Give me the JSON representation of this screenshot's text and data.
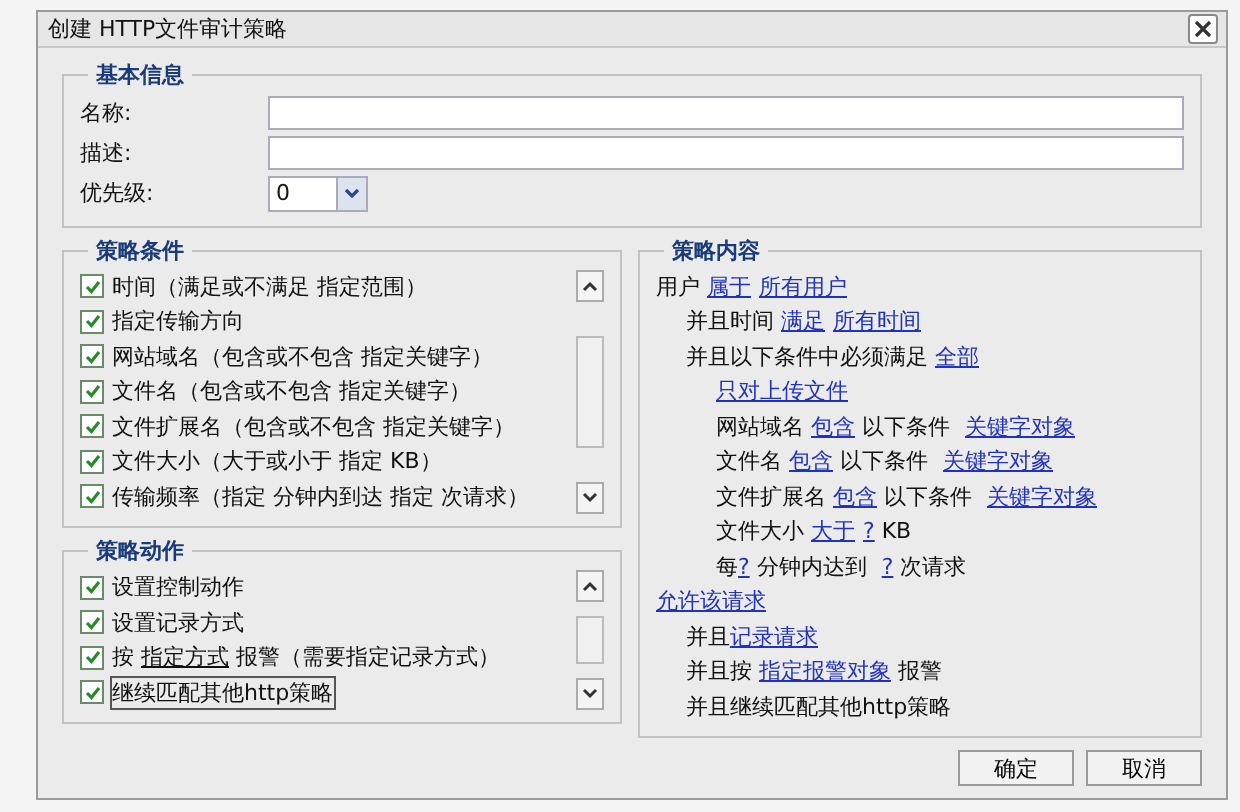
{
  "window": {
    "title": "创建  HTTP文件审计策略"
  },
  "basic_info": {
    "legend": "基本信息",
    "fields": [
      {
        "label": "名称:"
      },
      {
        "label": "描述:"
      }
    ],
    "priority": {
      "label": "优先级:",
      "value": "0"
    }
  },
  "conditions": {
    "legend": "策略条件",
    "items": [
      {
        "checked": true,
        "parts": [
          {
            "kind": "text",
            "text": "时间（满足或不满足 指定范围）"
          }
        ]
      },
      {
        "checked": true,
        "parts": [
          {
            "kind": "text",
            "text": "指定传输方向"
          }
        ]
      },
      {
        "checked": true,
        "parts": [
          {
            "kind": "text",
            "text": "网站域名（包含或不包含 指定关键字）"
          }
        ]
      },
      {
        "checked": true,
        "parts": [
          {
            "kind": "text",
            "text": "文件名（包含或不包含 指定关键字）"
          }
        ]
      },
      {
        "checked": true,
        "parts": [
          {
            "kind": "text",
            "text": "文件扩展名（包含或不包含 指定关键字）"
          }
        ]
      },
      {
        "checked": true,
        "parts": [
          {
            "kind": "text",
            "text": "文件大小（大于或小于 指定 KB）"
          }
        ]
      },
      {
        "checked": true,
        "parts": [
          {
            "kind": "text",
            "text": "传输频率（指定 分钟内到达 指定 次请求）"
          }
        ]
      }
    ]
  },
  "actions": {
    "legend": "策略动作",
    "items": [
      {
        "checked": true,
        "focused": false,
        "parts": [
          {
            "kind": "text",
            "text": "设置控制动作"
          }
        ]
      },
      {
        "checked": true,
        "focused": false,
        "parts": [
          {
            "kind": "text",
            "text": "设置记录方式"
          }
        ]
      },
      {
        "checked": true,
        "focused": false,
        "parts": [
          {
            "kind": "text",
            "text": "按 "
          },
          {
            "kind": "link",
            "text": "指定方式"
          },
          {
            "kind": "text",
            "text": " 报警（需要指定记录方式）"
          }
        ]
      },
      {
        "checked": true,
        "focused": true,
        "parts": [
          {
            "kind": "text",
            "text": "继续匹配其他http策略"
          }
        ]
      }
    ]
  },
  "content": {
    "legend": "策略内容",
    "lines": [
      {
        "parts": [
          {
            "kind": "text",
            "text": "用户 "
          },
          {
            "kind": "link",
            "text": "属于"
          },
          {
            "kind": "link",
            "text": "所有用户"
          }
        ],
        "children": [
          {
            "parts": [
              {
                "kind": "text",
                "text": "并且时间 "
              },
              {
                "kind": "link",
                "text": "满足"
              },
              {
                "kind": "link",
                "text": "所有时间"
              }
            ]
          },
          {
            "parts": [
              {
                "kind": "text",
                "text": "并且以下条件中必须满足 "
              },
              {
                "kind": "link",
                "text": "全部"
              }
            ],
            "children": [
              {
                "parts": [
                  {
                    "kind": "link",
                    "text": "只对上传文件"
                  }
                ]
              },
              {
                "parts": [
                  {
                    "kind": "text",
                    "text": "网站域名 "
                  },
                  {
                    "kind": "link",
                    "text": "包含"
                  },
                  {
                    "kind": "text",
                    "text": " 以下条件 "
                  },
                  {
                    "kind": "link",
                    "text": "关键字对象"
                  }
                ]
              },
              {
                "parts": [
                  {
                    "kind": "text",
                    "text": "文件名 "
                  },
                  {
                    "kind": "link",
                    "text": "包含"
                  },
                  {
                    "kind": "text",
                    "text": " 以下条件 "
                  },
                  {
                    "kind": "link",
                    "text": "关键字对象"
                  }
                ]
              },
              {
                "parts": [
                  {
                    "kind": "text",
                    "text": "文件扩展名 "
                  },
                  {
                    "kind": "link",
                    "text": "包含"
                  },
                  {
                    "kind": "text",
                    "text": " 以下条件 "
                  },
                  {
                    "kind": "link",
                    "text": "关键字对象"
                  }
                ]
              },
              {
                "parts": [
                  {
                    "kind": "text",
                    "text": "文件大小 "
                  },
                  {
                    "kind": "link",
                    "text": "大于"
                  },
                  {
                    "kind": "link",
                    "text": "?"
                  },
                  {
                    "kind": "text",
                    "text": " KB"
                  }
                ]
              },
              {
                "parts": [
                  {
                    "kind": "text",
                    "text": "每"
                  },
                  {
                    "kind": "link",
                    "text": "?"
                  },
                  {
                    "kind": "text",
                    "text": " 分钟内达到 "
                  },
                  {
                    "kind": "link",
                    "text": "?"
                  },
                  {
                    "kind": "text",
                    "text": " 次请求"
                  }
                ]
              }
            ]
          }
        ]
      },
      {
        "parts": [
          {
            "kind": "link",
            "text": "允许该请求"
          }
        ],
        "children": [
          {
            "parts": [
              {
                "kind": "text",
                "text": "并且"
              },
              {
                "kind": "link",
                "text": "记录请求"
              }
            ]
          },
          {
            "parts": [
              {
                "kind": "text",
                "text": "并且按 "
              },
              {
                "kind": "link",
                "text": "指定报警对象"
              },
              {
                "kind": "text",
                "text": " 报警"
              }
            ]
          },
          {
            "parts": [
              {
                "kind": "text",
                "text": "并且继续匹配其他http策略"
              }
            ]
          }
        ]
      }
    ]
  },
  "buttons": [
    "确定",
    "取消"
  ]
}
